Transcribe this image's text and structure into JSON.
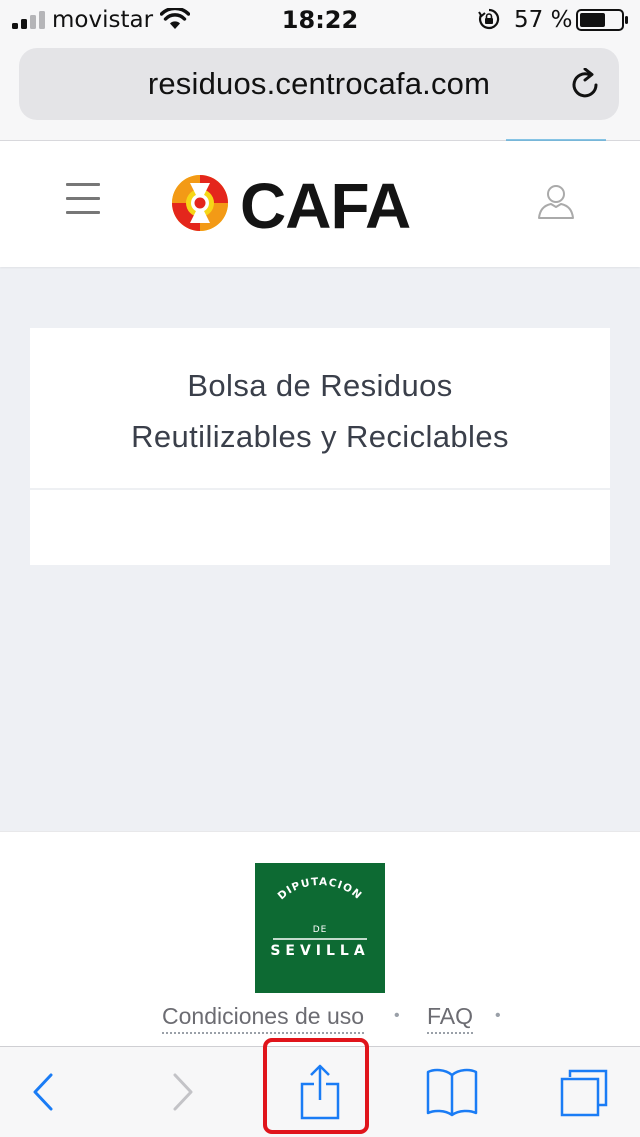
{
  "status_bar": {
    "carrier": "movistar",
    "time": "18:22",
    "battery_percent": "57 %",
    "signal_bars_filled": 2,
    "signal_bars_total": 4
  },
  "browser": {
    "url": "residuos.centrocafa.com"
  },
  "site": {
    "logo_text": "CAFA",
    "brand_colors": {
      "red": "#e4261c",
      "orange": "#f39a16",
      "yellow": "#f6d616"
    }
  },
  "card": {
    "title_line1": "Bolsa de Residuos",
    "title_line2": "Reutilizables y Reciclables"
  },
  "footer": {
    "partner_logo": {
      "line1": "DIPUTACION",
      "line2": "DE",
      "line3": "SEVILLA",
      "color": "#0d6a33"
    },
    "links": [
      {
        "label": "Condiciones de uso"
      },
      {
        "label": "FAQ"
      }
    ],
    "separator": "•"
  },
  "toolbar": {
    "highlight_color": "#e0141b",
    "accent": "#1a7cf5"
  }
}
